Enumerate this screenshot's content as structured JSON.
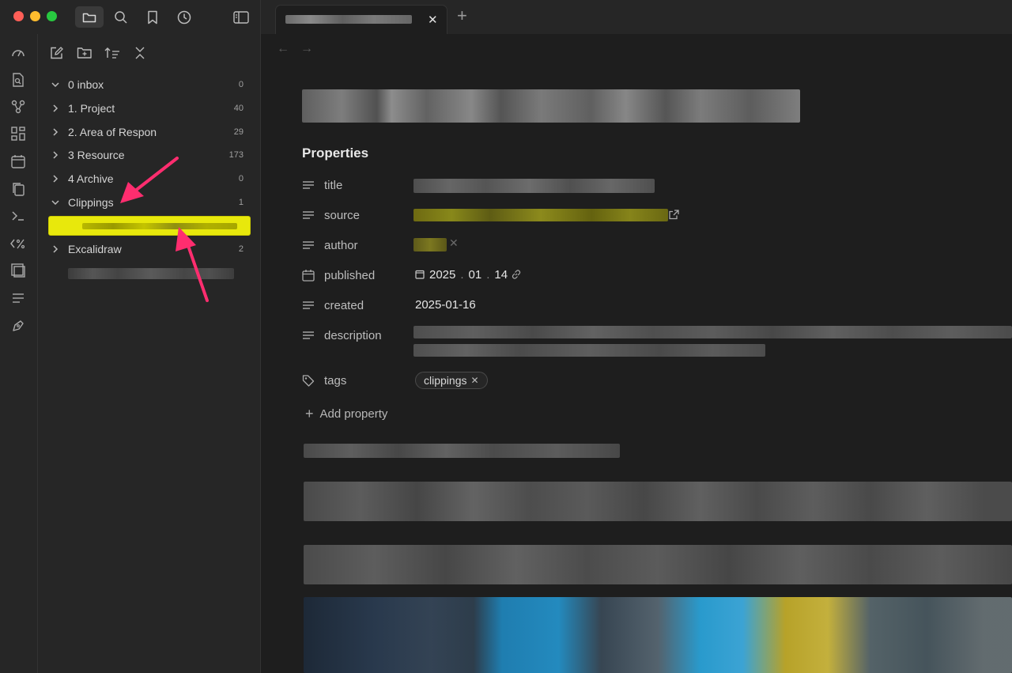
{
  "tab": {
    "close_label": "✕",
    "new_tab_label": "+"
  },
  "explorer": {
    "folders": [
      {
        "label": "0 inbox",
        "count": "0",
        "expanded": true
      },
      {
        "label": "1. Project",
        "count": "40",
        "expanded": false
      },
      {
        "label": "2. Area of Respon",
        "count": "29",
        "expanded": false
      },
      {
        "label": "3 Resource",
        "count": "173",
        "expanded": false
      },
      {
        "label": "4 Archive",
        "count": "0",
        "expanded": false
      },
      {
        "label": "Clippings",
        "count": "1",
        "expanded": true
      },
      {
        "label": "Excalidraw",
        "count": "2",
        "expanded": false
      }
    ]
  },
  "properties": {
    "heading": "Properties",
    "items": [
      {
        "name": "title",
        "icon": "text-lines-icon"
      },
      {
        "name": "source",
        "icon": "text-lines-icon"
      },
      {
        "name": "author",
        "icon": "text-lines-icon"
      },
      {
        "name": "published",
        "icon": "calendar-icon"
      },
      {
        "name": "created",
        "icon": "text-lines-icon"
      },
      {
        "name": "description",
        "icon": "text-lines-icon"
      },
      {
        "name": "tags",
        "icon": "tags-icon"
      }
    ],
    "published_year": "2025",
    "published_month": "01",
    "published_day": "14",
    "created_value": "2025-01-16",
    "tag": "clippings",
    "add_property_label": "Add property"
  },
  "colors": {
    "accent_highlight": "#e8e80c",
    "arrow": "#ff2d6f",
    "background": "#1e1e1e",
    "sidebar": "#262626"
  }
}
